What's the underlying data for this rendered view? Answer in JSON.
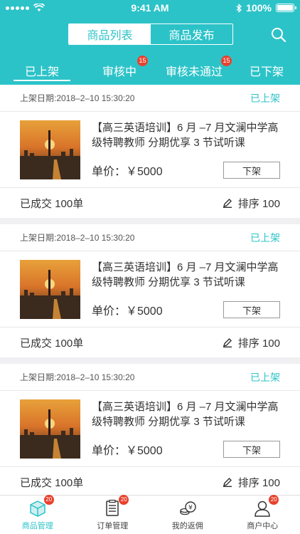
{
  "status_bar": {
    "time": "9:41 AM",
    "battery": "100%"
  },
  "header": {
    "segments": [
      {
        "label": "商品列表",
        "active": true
      },
      {
        "label": "商品发布",
        "active": false
      }
    ],
    "tabs": [
      {
        "label": "已上架",
        "active": true,
        "badge": ""
      },
      {
        "label": "审核中",
        "active": false,
        "badge": "15"
      },
      {
        "label": "审核未通过",
        "active": false,
        "badge": "15"
      },
      {
        "label": "已下架",
        "active": false,
        "badge": ""
      }
    ]
  },
  "products": [
    {
      "date": "上架日期:2018–2–10   15:30:20",
      "status": "已上架",
      "title": "【高三英语培训】6 月 –7 月文澜中学高级特聘教师  分期优享 3 节试听课",
      "price": "单价：￥5000",
      "off_label": "下架",
      "sold": "已成交   100单",
      "sort": "排序 100"
    },
    {
      "date": "上架日期:2018–2–10   15:30:20",
      "status": "已上架",
      "title": "【高三英语培训】6 月 –7 月文澜中学高级特聘教师  分期优享 3 节试听课",
      "price": "单价：￥5000",
      "off_label": "下架",
      "sold": "已成交   100单",
      "sort": "排序 100"
    },
    {
      "date": "上架日期:2018–2–10   15:30:20",
      "status": "已上架",
      "title": "【高三英语培训】6 月 –7 月文澜中学高级特聘教师  分期优享 3 节试听课",
      "price": "单价：￥5000",
      "off_label": "下架",
      "sold": "已成交   100单",
      "sort": "排序 100"
    }
  ],
  "tabbar": [
    {
      "label": "商品管理",
      "icon": "box-icon",
      "badge": "20",
      "active": true
    },
    {
      "label": "订单管理",
      "icon": "order-list-icon",
      "badge": "20",
      "active": false
    },
    {
      "label": "我的返佣",
      "icon": "coins-icon",
      "badge": "",
      "active": false
    },
    {
      "label": "商户中心",
      "icon": "user-icon",
      "badge": "20",
      "active": false
    }
  ],
  "colors": {
    "accent": "#2cc3c8",
    "badge": "#e8412c"
  }
}
